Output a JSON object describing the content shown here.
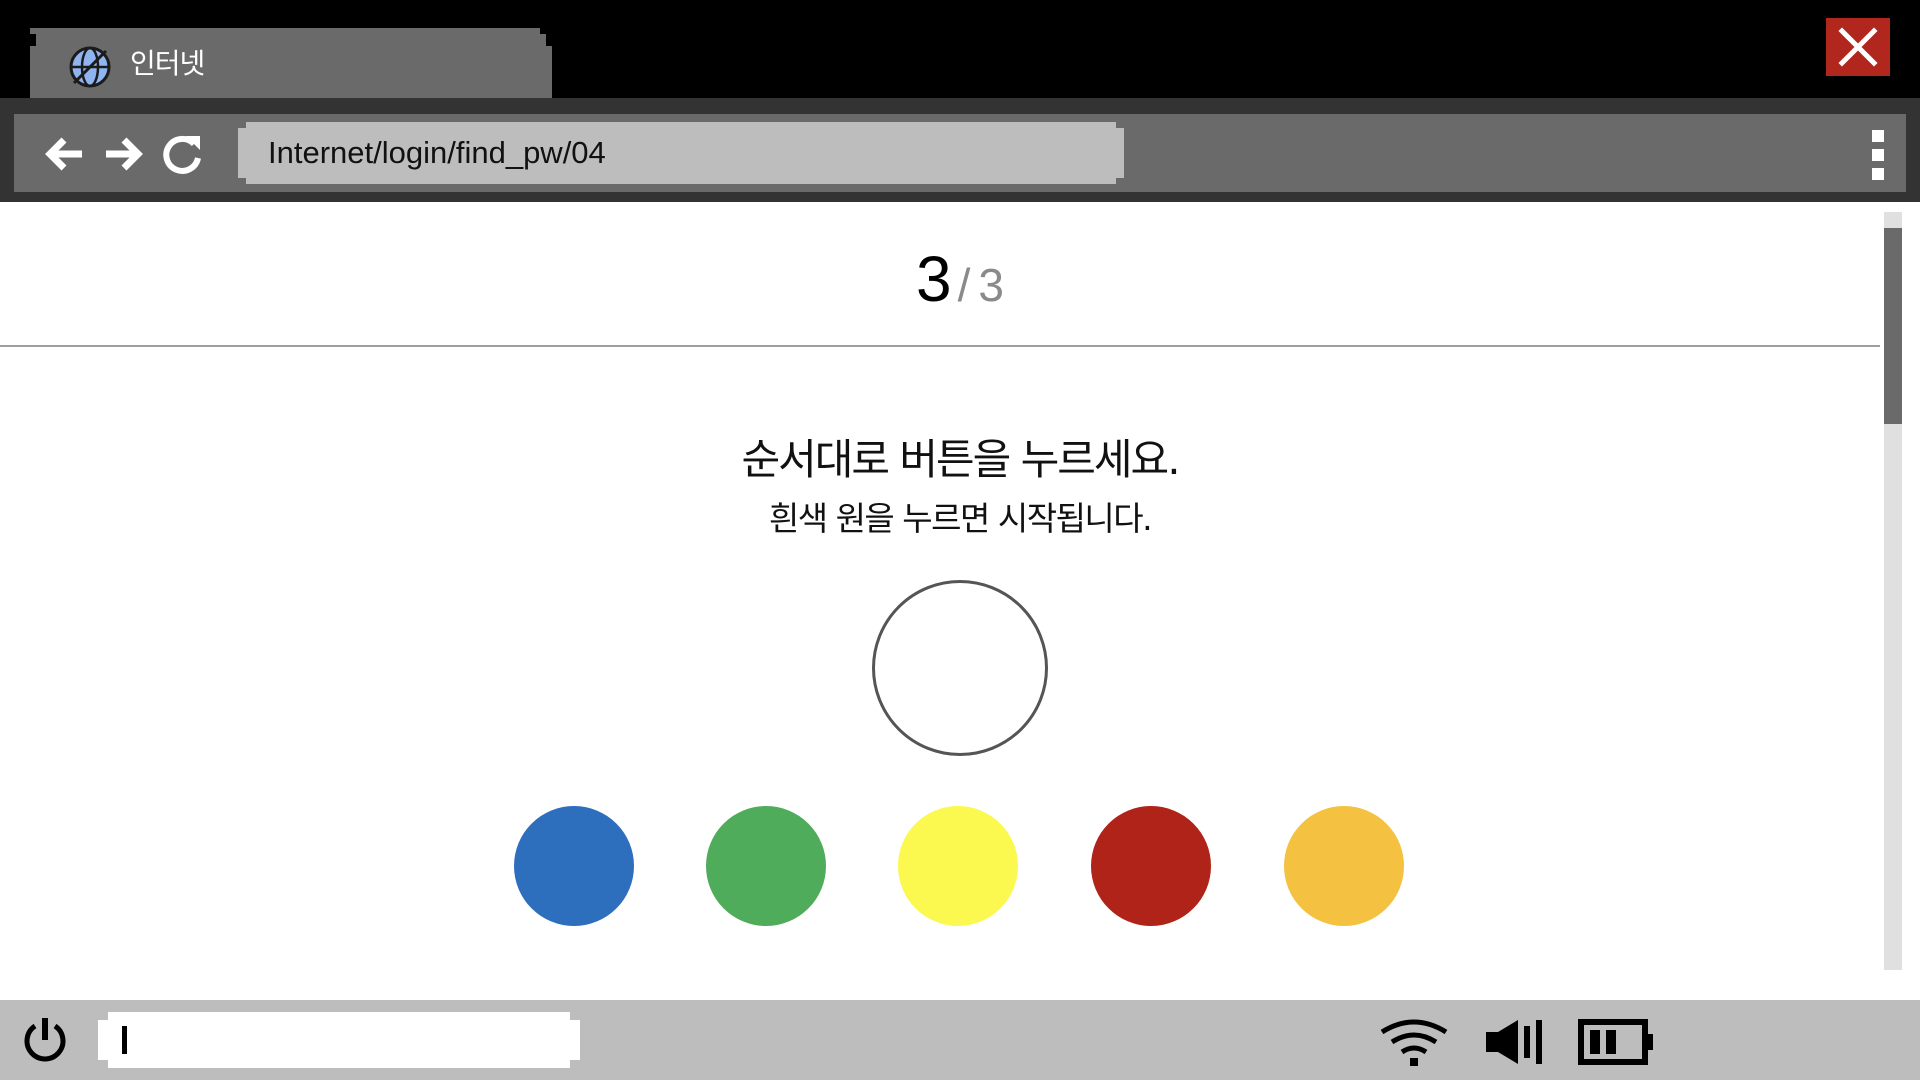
{
  "browser": {
    "tab_title": "인터넷",
    "tab_icon": "globe-icon",
    "url": "Internet/login/find_pw/04"
  },
  "nav": {
    "back_icon": "back-arrow-icon",
    "forward_icon": "forward-arrow-icon",
    "reload_icon": "reload-icon",
    "menu_icon": "menu-dots-icon"
  },
  "page": {
    "step_current": "3",
    "step_separator": "/",
    "step_total": "3",
    "instruction": "순서대로 버튼을 누르세요.",
    "sub_instruction": "흰색 원을 누르면 시작됩니다."
  },
  "buttons": [
    {
      "name": "blue",
      "color": "#2d6ebd"
    },
    {
      "name": "green",
      "color": "#4fac5b"
    },
    {
      "name": "yellow",
      "color": "#fbf84f"
    },
    {
      "name": "red",
      "color": "#b02318"
    },
    {
      "name": "orange",
      "color": "#f4c141"
    }
  ],
  "start_circle_color": "#ffffff",
  "taskbar": {
    "power_icon": "power-icon",
    "wifi_icon": "wifi-icon",
    "volume_icon": "volume-icon",
    "battery_icon": "battery-icon",
    "input_value": ""
  },
  "colors": {
    "titlebar": "#000000",
    "tab": "#6a6a6a",
    "close": "#b1261d",
    "url_bar": "#bdbdbd",
    "taskbar": "#bdbdbd"
  }
}
